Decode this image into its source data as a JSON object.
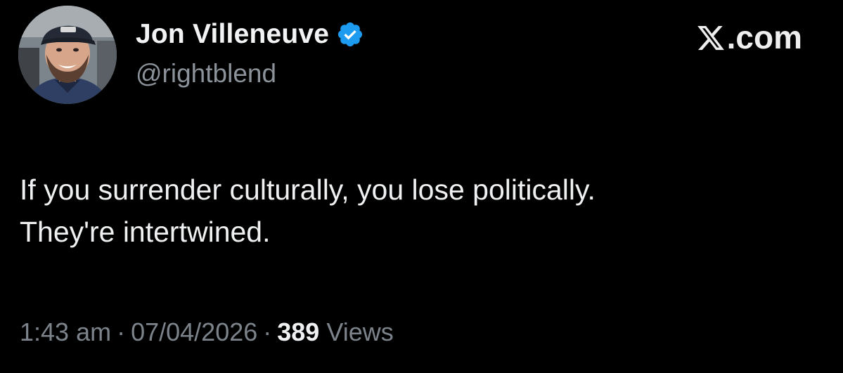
{
  "author": {
    "display_name": "Jon Villeneuve",
    "handle": "@rightblend",
    "verified": true,
    "avatar_icon": "profile-photo-man-in-cap"
  },
  "brand": {
    "logo_icon": "x-logo-icon",
    "suffix": ".com"
  },
  "tweet": {
    "lines": [
      "If you surrender culturally, you lose politically.",
      "They're intertwined."
    ]
  },
  "meta": {
    "time": "1:43 am",
    "separator": "·",
    "date": "07/04/2026",
    "views_count": "389",
    "views_label": "Views"
  },
  "colors": {
    "background": "#000000",
    "text": "#eef0f1",
    "secondary_text": "#7c838a",
    "verified_blue": "#1d9bf0"
  }
}
